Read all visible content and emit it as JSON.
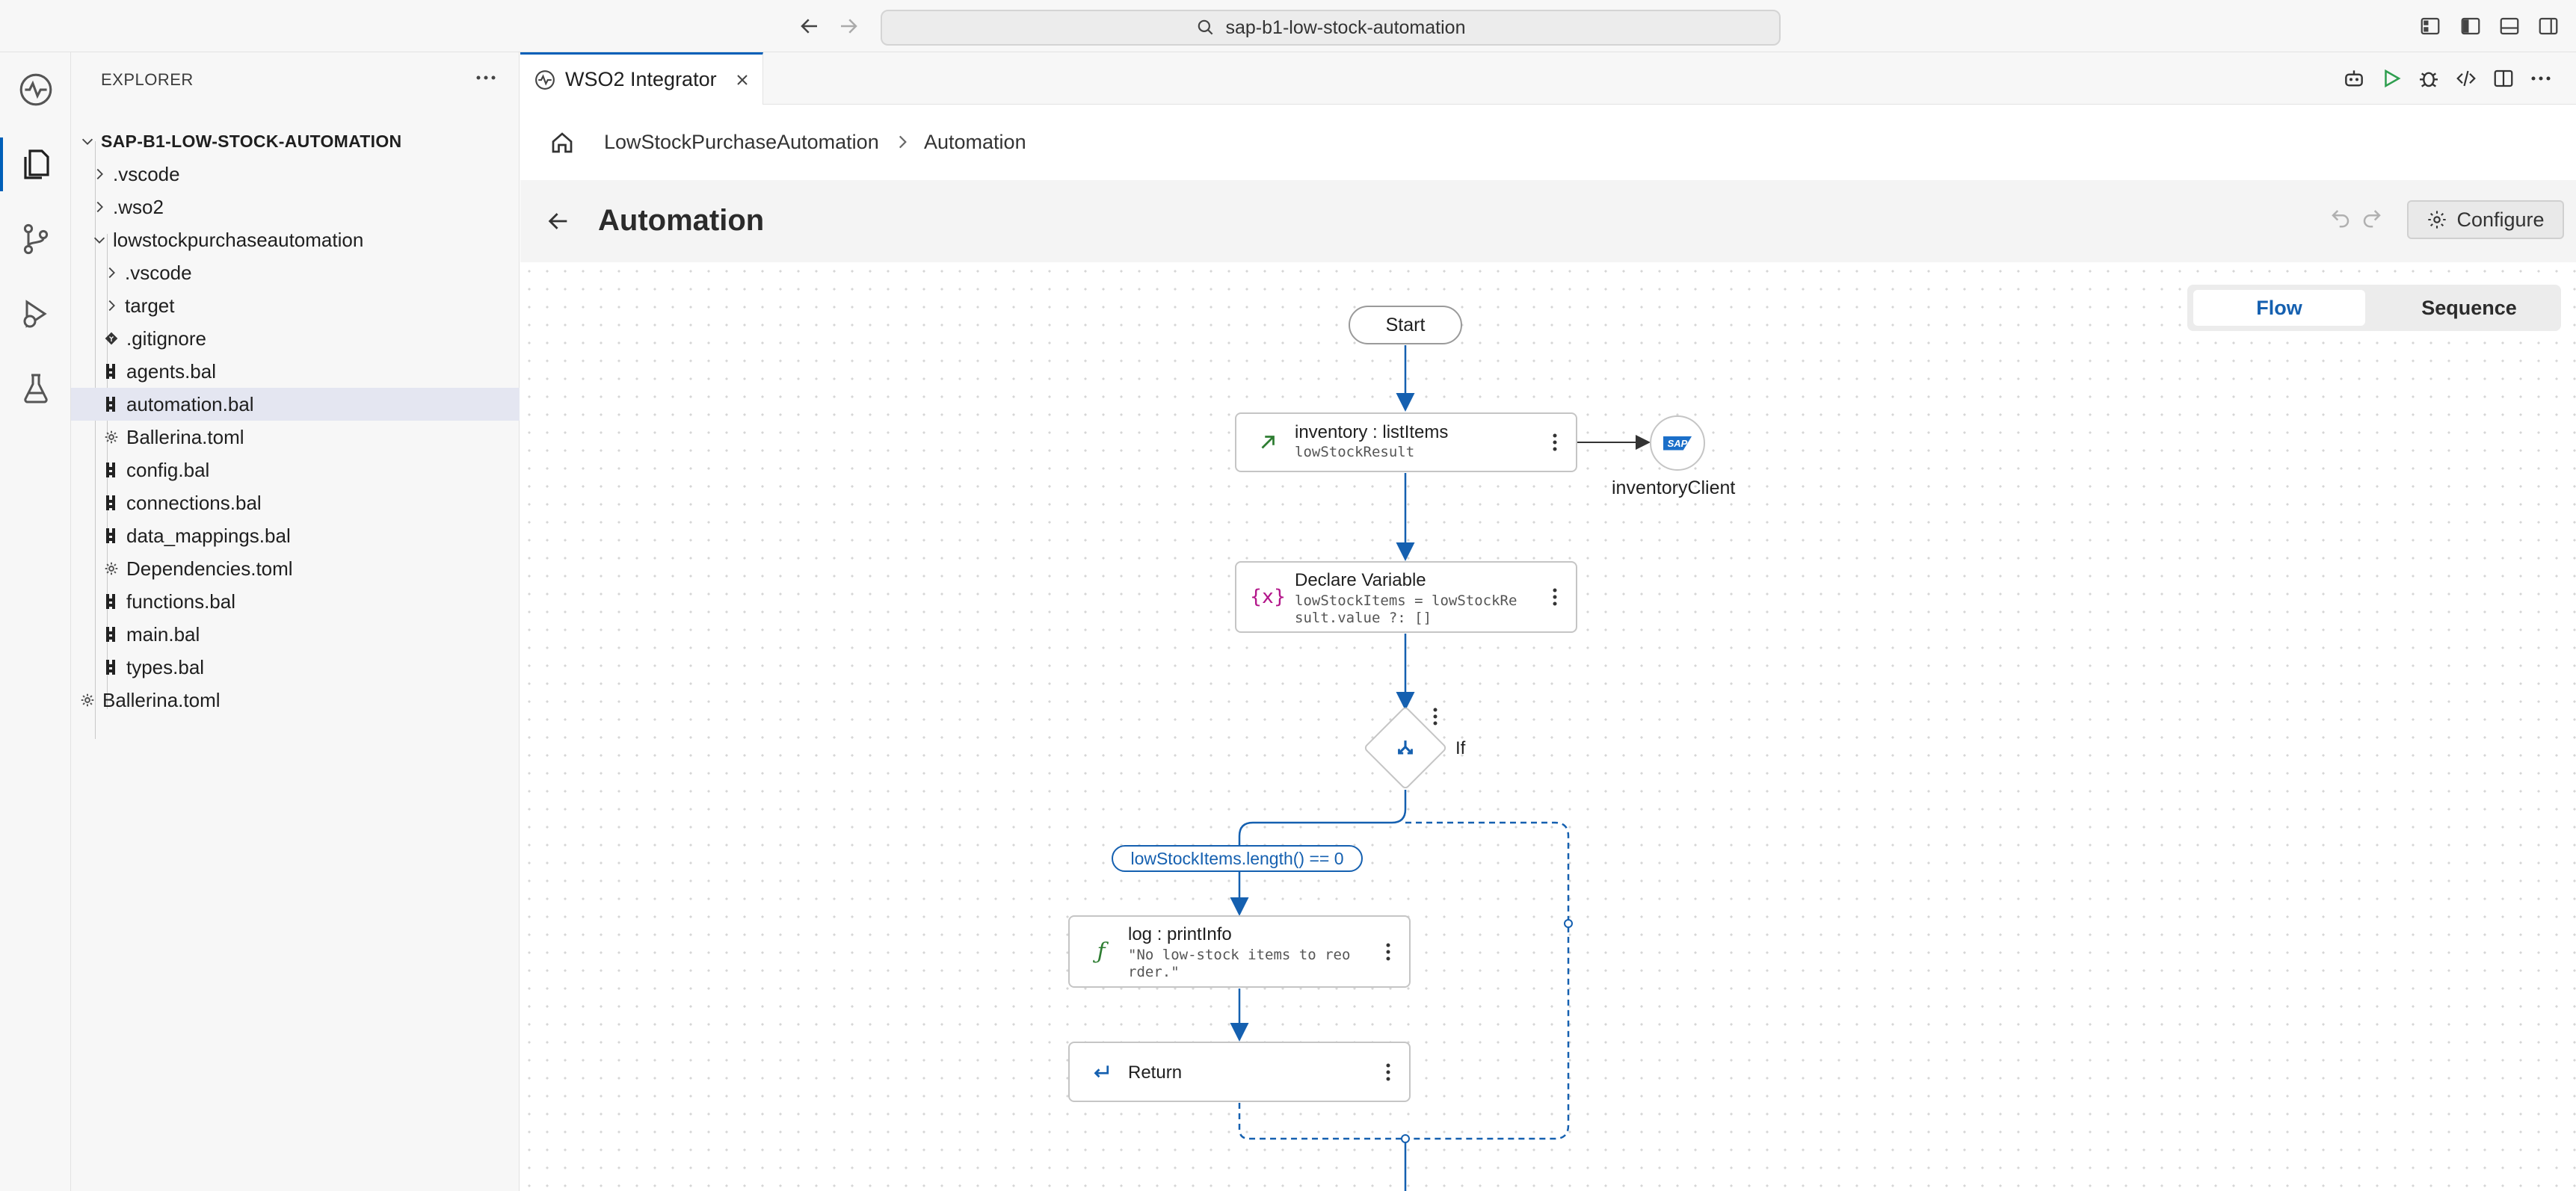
{
  "titlebar": {
    "search_text": "sap-b1-low-stock-automation"
  },
  "explorer": {
    "title": "EXPLORER",
    "items": [
      {
        "label": "SAP-B1-LOW-STOCK-AUTOMATION",
        "icon": "chevron-down-icon"
      },
      {
        "label": ".vscode",
        "icon": "chevron-right-icon"
      },
      {
        "label": ".wso2",
        "icon": "chevron-right-icon"
      },
      {
        "label": "lowstockpurchaseautomation",
        "icon": "chevron-down-icon"
      },
      {
        "label": ".vscode",
        "icon": "chevron-right-icon"
      },
      {
        "label": "target",
        "icon": "chevron-right-icon"
      },
      {
        "label": ".gitignore",
        "icon": "git-file-icon"
      },
      {
        "label": "agents.bal",
        "icon": "ballerina-file-icon"
      },
      {
        "label": "automation.bal",
        "icon": "ballerina-file-icon"
      },
      {
        "label": "Ballerina.toml",
        "icon": "gear-file-icon"
      },
      {
        "label": "config.bal",
        "icon": "ballerina-file-icon"
      },
      {
        "label": "connections.bal",
        "icon": "ballerina-file-icon"
      },
      {
        "label": "data_mappings.bal",
        "icon": "ballerina-file-icon"
      },
      {
        "label": "Dependencies.toml",
        "icon": "gear-file-icon"
      },
      {
        "label": "functions.bal",
        "icon": "ballerina-file-icon"
      },
      {
        "label": "main.bal",
        "icon": "ballerina-file-icon"
      },
      {
        "label": "types.bal",
        "icon": "ballerina-file-icon"
      },
      {
        "label": "Ballerina.toml",
        "icon": "gear-file-icon"
      }
    ]
  },
  "tab": {
    "label": "WSO2 Integrator"
  },
  "breadcrumb": {
    "items": [
      "LowStockPurchaseAutomation",
      "Automation"
    ]
  },
  "header": {
    "title": "Automation",
    "configure_label": "Configure"
  },
  "view_toggle": {
    "options": [
      "Flow",
      "Sequence"
    ],
    "selected": "Flow"
  },
  "flow": {
    "start": "Start",
    "nodes": [
      {
        "title": "inventory : listItems",
        "subtitle": "lowStockResult",
        "icon": "arrow-up-right-icon"
      },
      {
        "title": "Declare Variable",
        "subtitle": "lowStockItems = lowStockRe\nsult.value ?: []",
        "icon": "variable-icon"
      },
      {
        "title": "log : printInfo",
        "subtitle": "\"No low-stock items to reo\nrder.\"",
        "icon": "function-icon"
      },
      {
        "title": "Return",
        "subtitle": "",
        "icon": "return-icon"
      }
    ],
    "if_label": "If",
    "condition": "lowStockItems.length() == 0",
    "client_label": "inventoryClient",
    "client_logo": "SAP"
  },
  "colors": {
    "accent": "#1560b0",
    "selected_row": "#e4e6f1",
    "variable_icon": "#b3168a",
    "green_icon": "#2e7d32"
  }
}
